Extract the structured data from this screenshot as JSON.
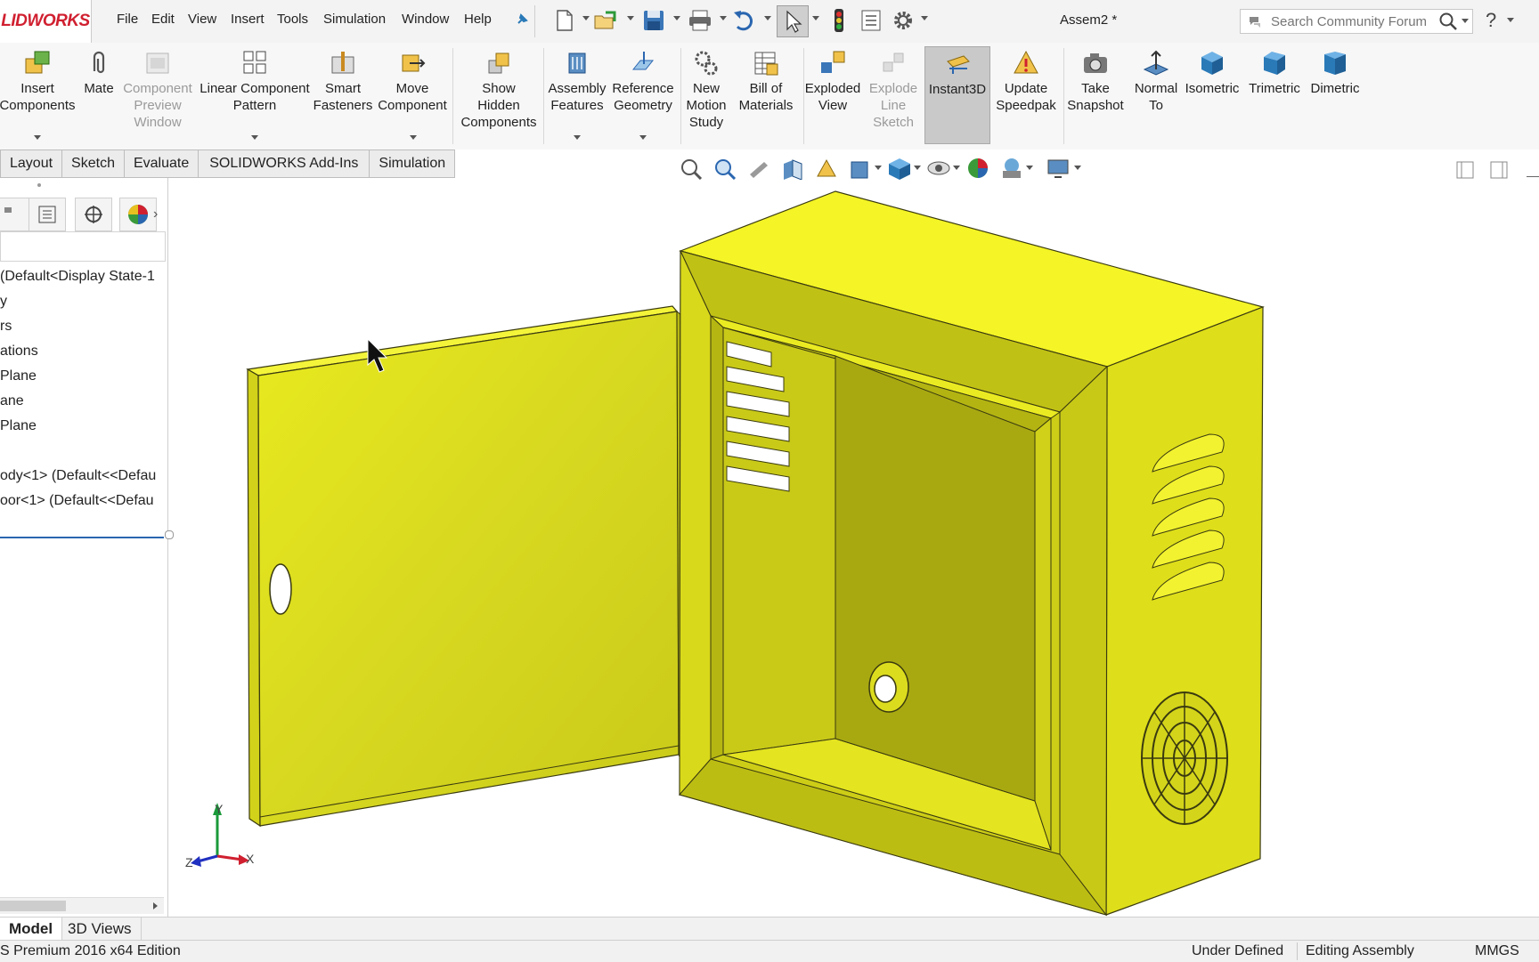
{
  "app": {
    "logo_text": "LIDWORKS",
    "doc_title": "Assem2 *",
    "accent": "#d02030"
  },
  "menu": [
    "File",
    "Edit",
    "View",
    "Insert",
    "Tools",
    "Simulation",
    "Window",
    "Help"
  ],
  "search": {
    "placeholder": "Search Community Forum"
  },
  "ribbon": [
    {
      "label": "Insert\nComponents",
      "icon": "insert-components-icon"
    },
    {
      "label": "Mate",
      "icon": "paperclip-icon"
    },
    {
      "label": "Component\nPreview\nWindow",
      "icon": "preview-window-icon"
    },
    {
      "label": "Linear Component\nPattern",
      "icon": "pattern-icon"
    },
    {
      "label": "Smart\nFasteners",
      "icon": "fastener-icon"
    },
    {
      "label": "Move\nComponent",
      "icon": "move-component-icon"
    },
    {
      "label": "Show\nHidden\nComponents",
      "icon": "show-hidden-icon"
    },
    {
      "label": "Assembly\nFeatures",
      "icon": "assembly-features-icon"
    },
    {
      "label": "Reference\nGeometry",
      "icon": "reference-geometry-icon"
    },
    {
      "label": "New\nMotion\nStudy",
      "icon": "motion-study-icon"
    },
    {
      "label": "Bill of\nMaterials",
      "icon": "bom-icon"
    },
    {
      "label": "Exploded\nView",
      "icon": "exploded-view-icon"
    },
    {
      "label": "Explode\nLine\nSketch",
      "icon": "explode-line-icon"
    },
    {
      "label": "Instant3D",
      "icon": "instant3d-icon"
    },
    {
      "label": "Update\nSpeedpak",
      "icon": "speedpak-icon"
    },
    {
      "label": "Take\nSnapshot",
      "icon": "camera-icon"
    },
    {
      "label": "Normal\nTo",
      "icon": "normal-to-icon"
    },
    {
      "label": "Isometric",
      "icon": "isometric-cube-icon"
    },
    {
      "label": "Trimetric",
      "icon": "trimetric-cube-icon"
    },
    {
      "label": "Dimetric",
      "icon": "dimetric-cube-icon"
    }
  ],
  "tabs": [
    "Layout",
    "Sketch",
    "Evaluate",
    "SOLIDWORKS Add-Ins",
    "Simulation"
  ],
  "tree": [
    "(Default<Display State-1",
    "y",
    "rs",
    "ations",
    "Plane",
    "ane",
    "Plane",
    "ody<1> (Default<<Defau",
    "oor<1> (Default<<Defau"
  ],
  "triad": {
    "x": "X",
    "y": "Y",
    "z": "Z"
  },
  "bottom_tabs": [
    "Model",
    "3D Views"
  ],
  "status": {
    "edition": "S Premium 2016 x64 Edition",
    "state": "Under Defined",
    "mode": "Editing Assembly",
    "units": "MMGS"
  },
  "colors": {
    "model_yellow": "#e6e600",
    "model_edge": "#3a3a10"
  }
}
